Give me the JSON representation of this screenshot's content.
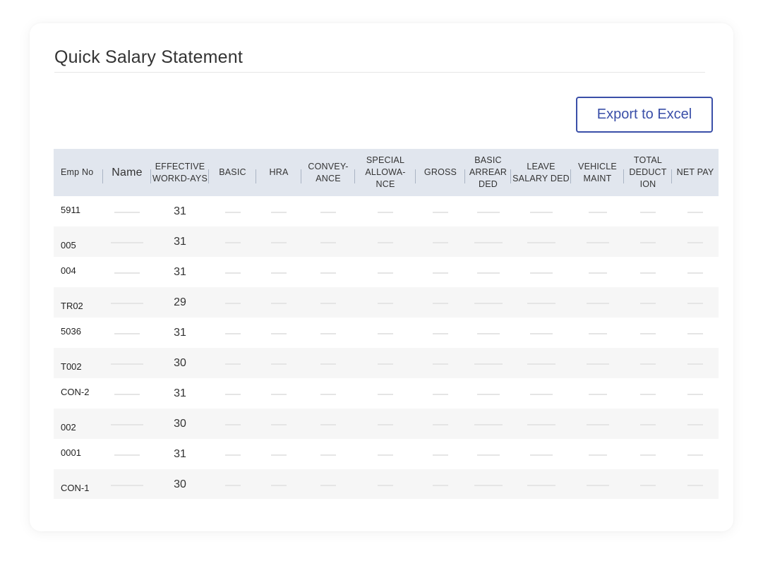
{
  "page": {
    "title": "Quick Salary Statement",
    "export_label": "Export to Excel"
  },
  "table": {
    "columns": [
      "Emp No",
      "Name",
      "EFFECTIVE WORKD-AYS",
      "BASIC",
      "HRA",
      "CONVEY-ANCE",
      "SPECIAL ALLOWA-NCE",
      "GROSS",
      "BASIC ARREAR DED",
      "LEAVE SALARY DED",
      "VEHICLE MAINT",
      "TOTAL DEDUCT ION",
      "NET PAY"
    ],
    "rows": [
      {
        "emp_no": "5911",
        "days": "31"
      },
      {
        "emp_no": "005",
        "days": "31"
      },
      {
        "emp_no": "004",
        "days": "31"
      },
      {
        "emp_no": "TR02",
        "days": "29"
      },
      {
        "emp_no": "5036",
        "days": "31"
      },
      {
        "emp_no": "T002",
        "days": "30"
      },
      {
        "emp_no": "CON-2",
        "days": "31"
      },
      {
        "emp_no": "002",
        "days": "30"
      },
      {
        "emp_no": "0001",
        "days": "31"
      },
      {
        "emp_no": "CON-1",
        "days": "30"
      }
    ]
  },
  "colors": {
    "accent": "#3a4fa8",
    "header_bg": "#e1e6ee",
    "stripe_bg": "#f6f6f6",
    "placeholder": "#e5e5e5"
  }
}
